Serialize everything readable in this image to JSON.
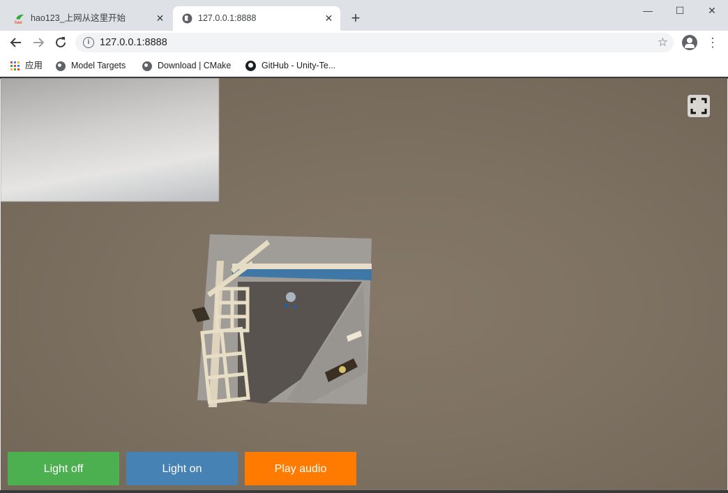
{
  "browser": {
    "tabs": [
      {
        "title": "hao123_上网从这里开始",
        "favicon": "hao123-icon",
        "active": false
      },
      {
        "title": "127.0.0.1:8888",
        "favicon": "globe-icon",
        "active": true
      }
    ],
    "new_tab": "+",
    "window_controls": {
      "minimize": "—",
      "maximize": "☐",
      "close": "✕"
    },
    "address": "127.0.0.1:8888",
    "bookmarks": [
      {
        "label": "应用",
        "icon": "apps-grid-icon"
      },
      {
        "label": "Model Targets",
        "icon": "globe-icon"
      },
      {
        "label": "Download | CMake",
        "icon": "globe-icon"
      },
      {
        "label": "GitHub - Unity-Te...",
        "icon": "github-icon"
      }
    ]
  },
  "app": {
    "buttons": {
      "light_off": "Light off",
      "light_on": "Light on",
      "play_audio": "Play audio"
    },
    "colors": {
      "light_off": "#4caf50",
      "light_on": "#4682b4",
      "play_audio": "#ff7b00",
      "ground": "#7d7162"
    }
  }
}
